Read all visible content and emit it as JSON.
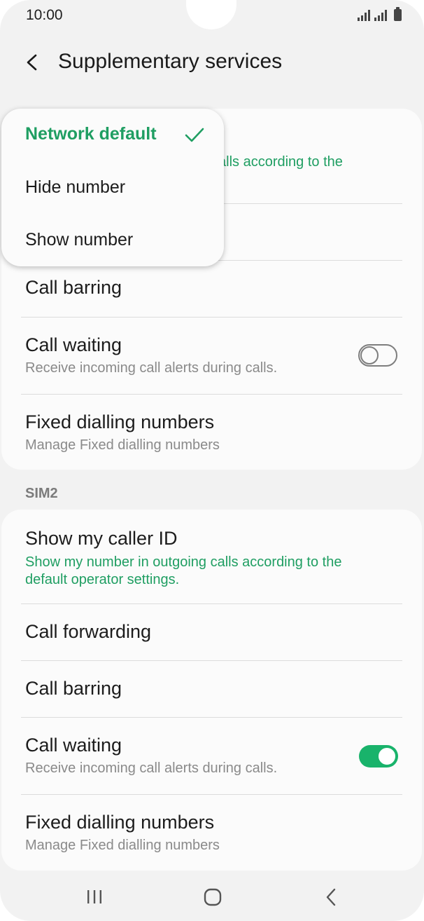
{
  "status_bar": {
    "time": "10:00",
    "icons": [
      "signal-sim1-icon",
      "signal-sim2-icon",
      "battery-icon"
    ]
  },
  "header": {
    "title": "Supplementary services",
    "back_icon": "chevron-left-icon"
  },
  "sim1": {
    "caller_id_sub_partial": "calls according to the",
    "call_barring": "Call barring",
    "call_waiting": {
      "title": "Call waiting",
      "subtitle": "Receive incoming call alerts during calls.",
      "enabled": false
    },
    "fdn": {
      "title": "Fixed dialling numbers",
      "subtitle": "Manage Fixed dialling numbers"
    }
  },
  "sim2": {
    "label": "SIM2",
    "caller_id": {
      "title": "Show my caller ID",
      "subtitle": "Show my number in outgoing calls according to the default operator settings."
    },
    "call_forwarding": "Call forwarding",
    "call_barring": "Call barring",
    "call_waiting": {
      "title": "Call waiting",
      "subtitle": "Receive incoming call alerts during calls.",
      "enabled": true
    },
    "fdn": {
      "title": "Fixed dialling numbers",
      "subtitle": "Manage Fixed dialling numbers"
    }
  },
  "caller_id_menu": {
    "options": [
      "Network default",
      "Hide number",
      "Show number"
    ],
    "selected": "Network default"
  },
  "colors": {
    "accent": "#1f9e62",
    "toggle_on": "#19b36b",
    "background": "#f2f2f2",
    "card": "#fbfbfb"
  },
  "nav_bar": {
    "icons": [
      "recents-icon",
      "home-icon",
      "back-icon"
    ]
  }
}
